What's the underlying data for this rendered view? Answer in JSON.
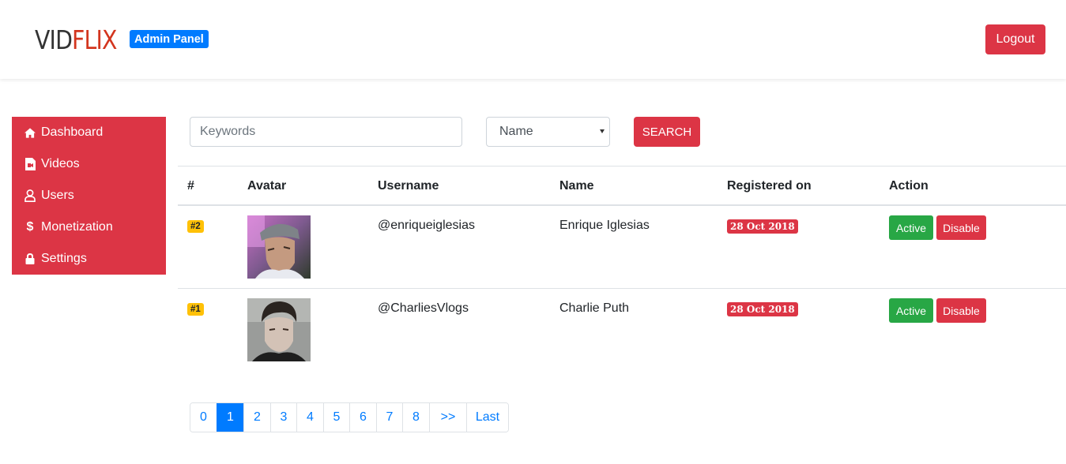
{
  "header": {
    "logo_part1": "VID",
    "logo_part2": "FLIX",
    "badge": "Admin Panel",
    "logout_label": "Logout"
  },
  "sidebar": {
    "items": [
      {
        "label": "Dashboard",
        "icon": "home-icon"
      },
      {
        "label": "Videos",
        "icon": "video-file-icon"
      },
      {
        "label": "Users",
        "icon": "user-icon"
      },
      {
        "label": "Monetization",
        "icon": "dollar-icon",
        "glyph": "$"
      },
      {
        "label": "Settings",
        "icon": "lock-icon"
      }
    ]
  },
  "search": {
    "placeholder": "Keywords",
    "value": "",
    "filter_selected": "Name",
    "button_label": "SEARCH"
  },
  "table": {
    "columns": [
      "#",
      "Avatar",
      "Username",
      "Name",
      "Registered on",
      "Action"
    ],
    "rows": [
      {
        "index": "#2",
        "username": "@enriqueiglesias",
        "name": "Enrique Iglesias",
        "registered": "28 Oct 2018",
        "active_label": "Active",
        "disable_label": "Disable"
      },
      {
        "index": "#1",
        "username": "@CharliesVlogs",
        "name": "Charlie Puth",
        "registered": "28 Oct 2018",
        "active_label": "Active",
        "disable_label": "Disable"
      }
    ]
  },
  "pagination": {
    "pages": [
      "0",
      "1",
      "2",
      "3",
      "4",
      "5",
      "6",
      "7",
      "8",
      ">>",
      "Last"
    ],
    "current": "1"
  },
  "colors": {
    "primary_red": "#dc3545",
    "blue": "#007bff",
    "green": "#28a745",
    "yellow": "#ffc107",
    "logo_red": "#d3351e"
  }
}
